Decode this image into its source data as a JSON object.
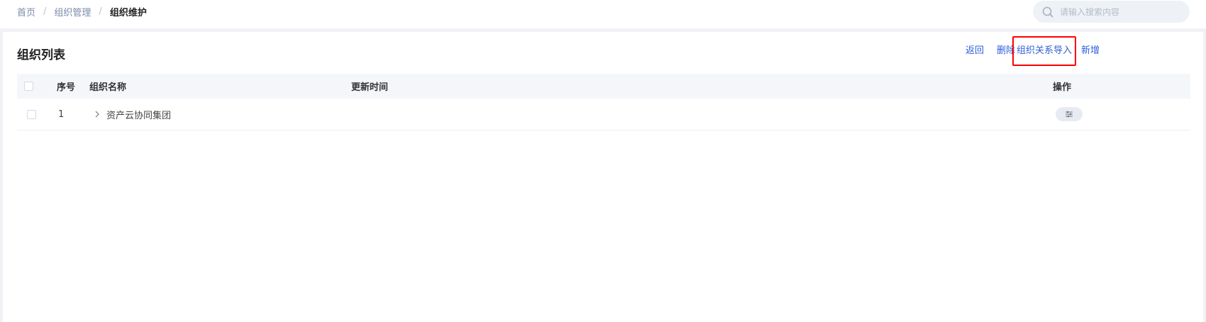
{
  "breadcrumb": {
    "items": [
      "首页",
      "组织管理"
    ],
    "current": "组织维护",
    "separator": "/"
  },
  "search": {
    "placeholder": "请输入搜索内容",
    "value": ""
  },
  "card": {
    "title": "组织列表",
    "actions": {
      "back": "返回",
      "delete": "删除",
      "import": "组织关系导入",
      "add": "新增"
    }
  },
  "table": {
    "columns": {
      "index": "序号",
      "name": "组织名称",
      "updated": "更新时间",
      "ops": "操作"
    },
    "rows": [
      {
        "index": "1",
        "name": "资产云协同集团",
        "updated": ""
      }
    ]
  },
  "icons": {
    "search": "search-icon",
    "expand": "chevron-right-icon",
    "ops": "sliders-icon"
  },
  "colors": {
    "link": "#2e5fd9",
    "highlight_border": "#ff0000",
    "header_bg": "#f4f6fa"
  }
}
